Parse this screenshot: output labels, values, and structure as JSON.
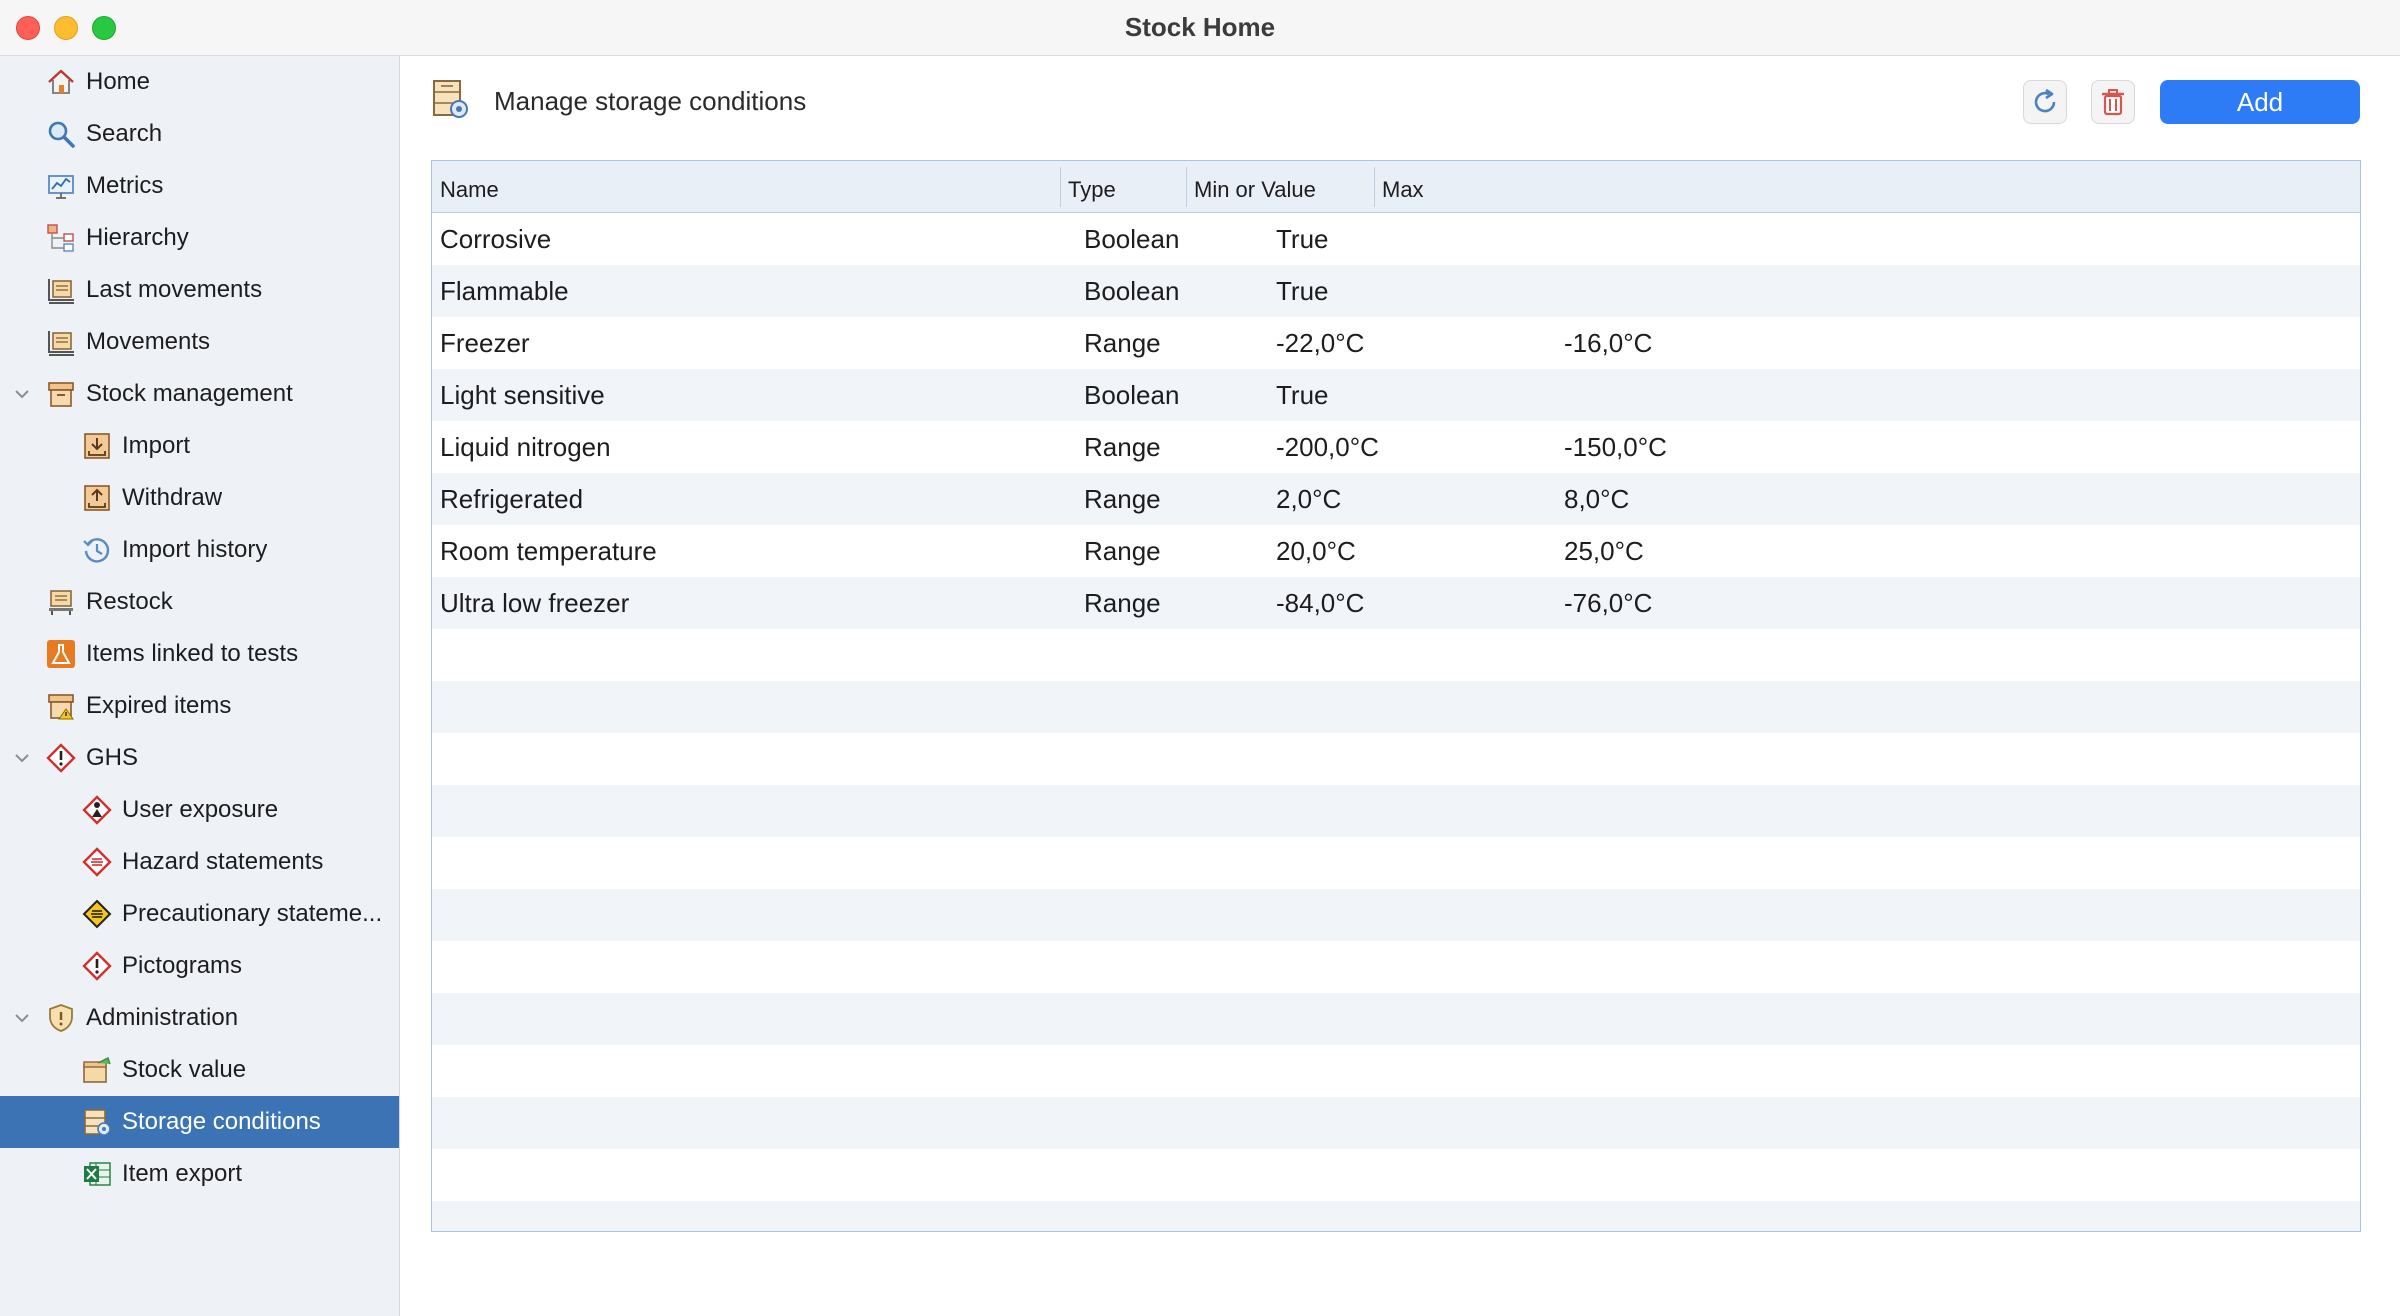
{
  "window": {
    "title": "Stock Home"
  },
  "sidebar": {
    "items": [
      {
        "label": "Home",
        "icon": "home-icon"
      },
      {
        "label": "Search",
        "icon": "search-icon"
      },
      {
        "label": "Metrics",
        "icon": "chart-icon"
      },
      {
        "label": "Hierarchy",
        "icon": "hierarchy-icon"
      },
      {
        "label": "Last movements",
        "icon": "pallet-icon"
      },
      {
        "label": "Movements",
        "icon": "pallet-icon"
      },
      {
        "label": "Stock management",
        "icon": "box-icon",
        "expanded": true
      },
      {
        "label": "Import",
        "icon": "tray-in-icon"
      },
      {
        "label": "Withdraw",
        "icon": "tray-out-icon"
      },
      {
        "label": "Import history",
        "icon": "history-icon"
      },
      {
        "label": "Restock",
        "icon": "restock-icon"
      },
      {
        "label": "Items linked to tests",
        "icon": "flask-icon"
      },
      {
        "label": "Expired items",
        "icon": "expired-box-icon"
      },
      {
        "label": "GHS",
        "icon": "ghs-warning-icon",
        "expanded": true
      },
      {
        "label": "User exposure",
        "icon": "ghs-exposure-icon"
      },
      {
        "label": "Hazard statements",
        "icon": "ghs-hazard-icon"
      },
      {
        "label": "Precautionary stateme...",
        "icon": "ghs-precaution-icon"
      },
      {
        "label": "Pictograms",
        "icon": "ghs-pictogram-icon"
      },
      {
        "label": "Administration",
        "icon": "shield-icon",
        "expanded": true
      },
      {
        "label": "Stock value",
        "icon": "stock-value-icon"
      },
      {
        "label": "Storage conditions",
        "icon": "storage-conditions-icon",
        "selected": true
      },
      {
        "label": "Item export",
        "icon": "excel-icon"
      }
    ]
  },
  "main": {
    "title": "Manage storage conditions",
    "add_label": "Add",
    "table": {
      "columns": [
        "Name",
        "Type",
        "Min or  Value",
        "Max"
      ],
      "rows": [
        {
          "name": "Corrosive",
          "type": "Boolean",
          "min": "True",
          "max": ""
        },
        {
          "name": "Flammable",
          "type": "Boolean",
          "min": "True",
          "max": ""
        },
        {
          "name": "Freezer",
          "type": "Range",
          "min": "-22,0°C",
          "max": "-16,0°C"
        },
        {
          "name": "Light sensitive",
          "type": "Boolean",
          "min": "True",
          "max": ""
        },
        {
          "name": "Liquid nitrogen",
          "type": "Range",
          "min": "-200,0°C",
          "max": "-150,0°C"
        },
        {
          "name": "Refrigerated",
          "type": "Range",
          "min": "2,0°C",
          "max": "8,0°C"
        },
        {
          "name": "Room temperature",
          "type": "Range",
          "min": "20,0°C",
          "max": "25,0°C"
        },
        {
          "name": "Ultra low freezer",
          "type": "Range",
          "min": "-84,0°C",
          "max": "-76,0°C"
        }
      ]
    }
  },
  "colors": {
    "accent": "#2d7cf6",
    "selection": "#3b73b5",
    "sidebar_bg": "#eef2f7",
    "row_stripe": "#f1f5fa"
  }
}
